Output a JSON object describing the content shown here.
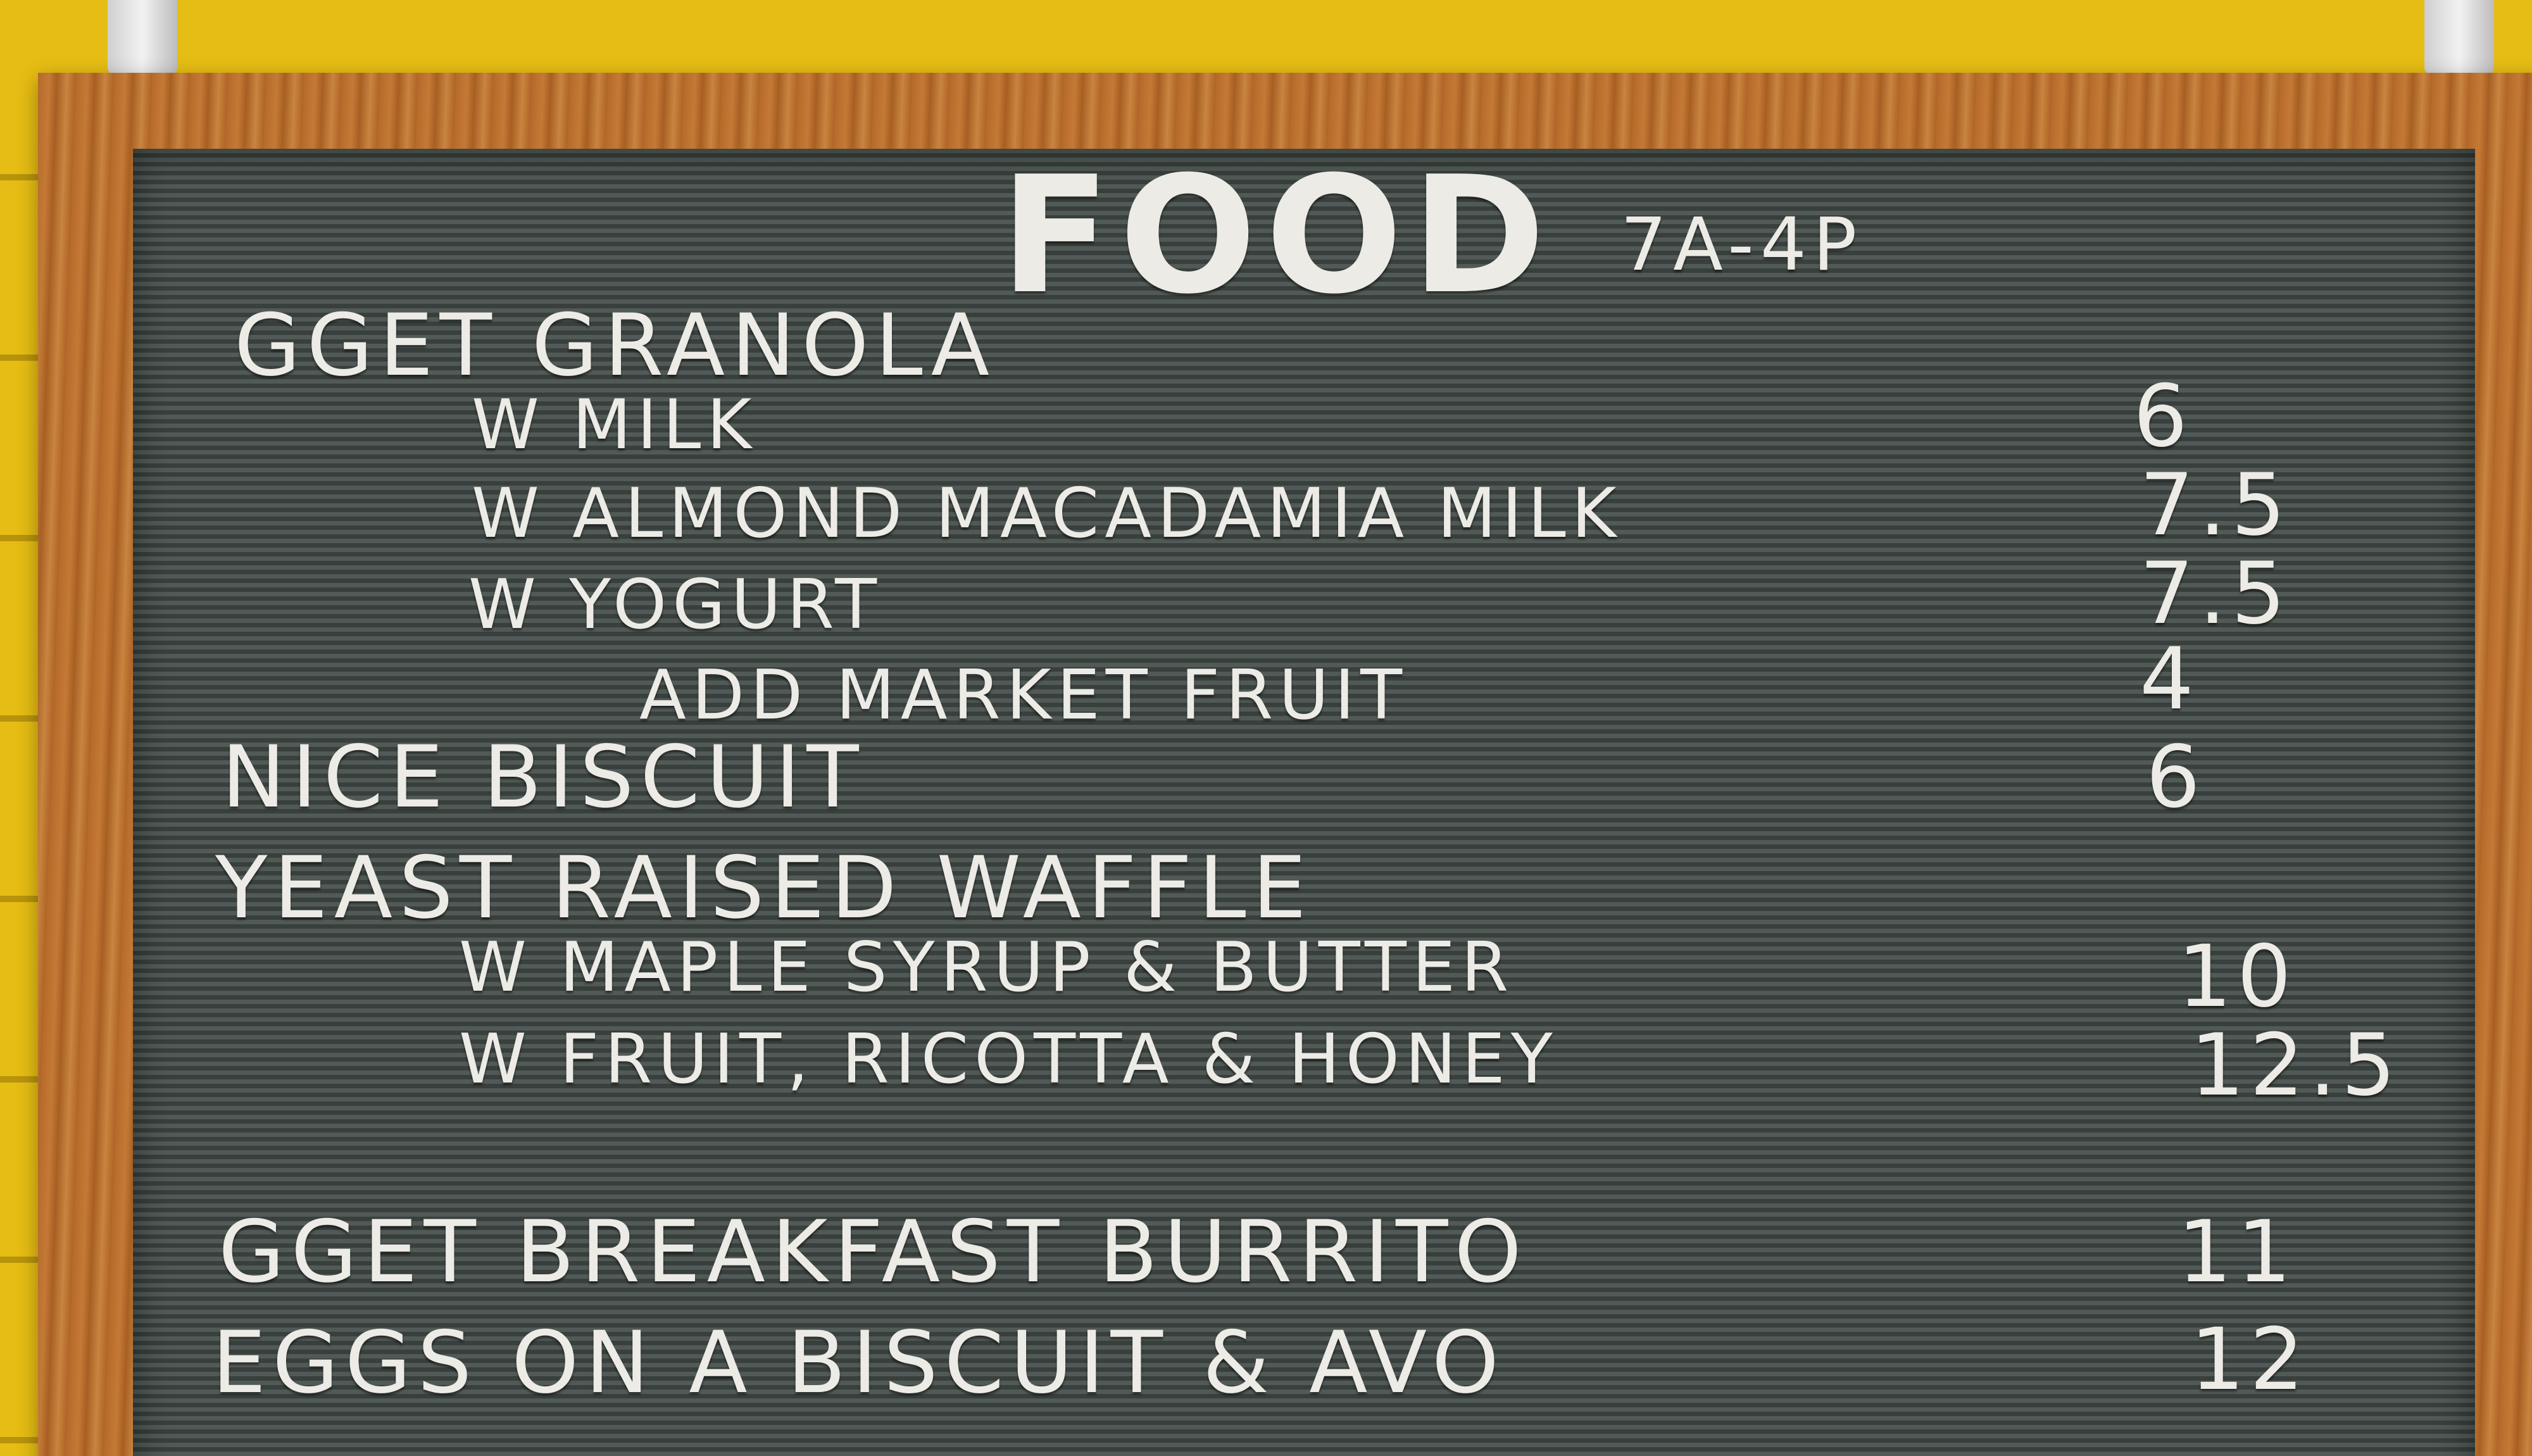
{
  "menu": {
    "title": "FOOD",
    "hours": "7A-4P",
    "items": [
      {
        "name": "GGET GRANOLA",
        "price": ""
      },
      {
        "name": "W MILK",
        "price": "6"
      },
      {
        "name": "W ALMOND MACADAMIA MILK",
        "price": "7.5"
      },
      {
        "name": "W YOGURT",
        "price": "7.5"
      },
      {
        "name": "ADD MARKET FRUIT",
        "price": "4"
      },
      {
        "name": "NICE BISCUIT",
        "price": "6"
      },
      {
        "name": "YEAST RAISED WAFFLE",
        "price": ""
      },
      {
        "name": "W MAPLE SYRUP & BUTTER",
        "price": "10"
      },
      {
        "name": "W FRUIT, RICOTTA & HONEY",
        "price": "12.5"
      },
      {
        "name": "GGET BREAKFAST BURRITO",
        "price": "11"
      },
      {
        "name": "EGGS ON A BISCUIT & AVO",
        "price": "12"
      }
    ]
  },
  "colors": {
    "wall": "#e6bd14",
    "frame": "#b66a2a",
    "board": "#48514d",
    "letters": "#ecebe6"
  }
}
